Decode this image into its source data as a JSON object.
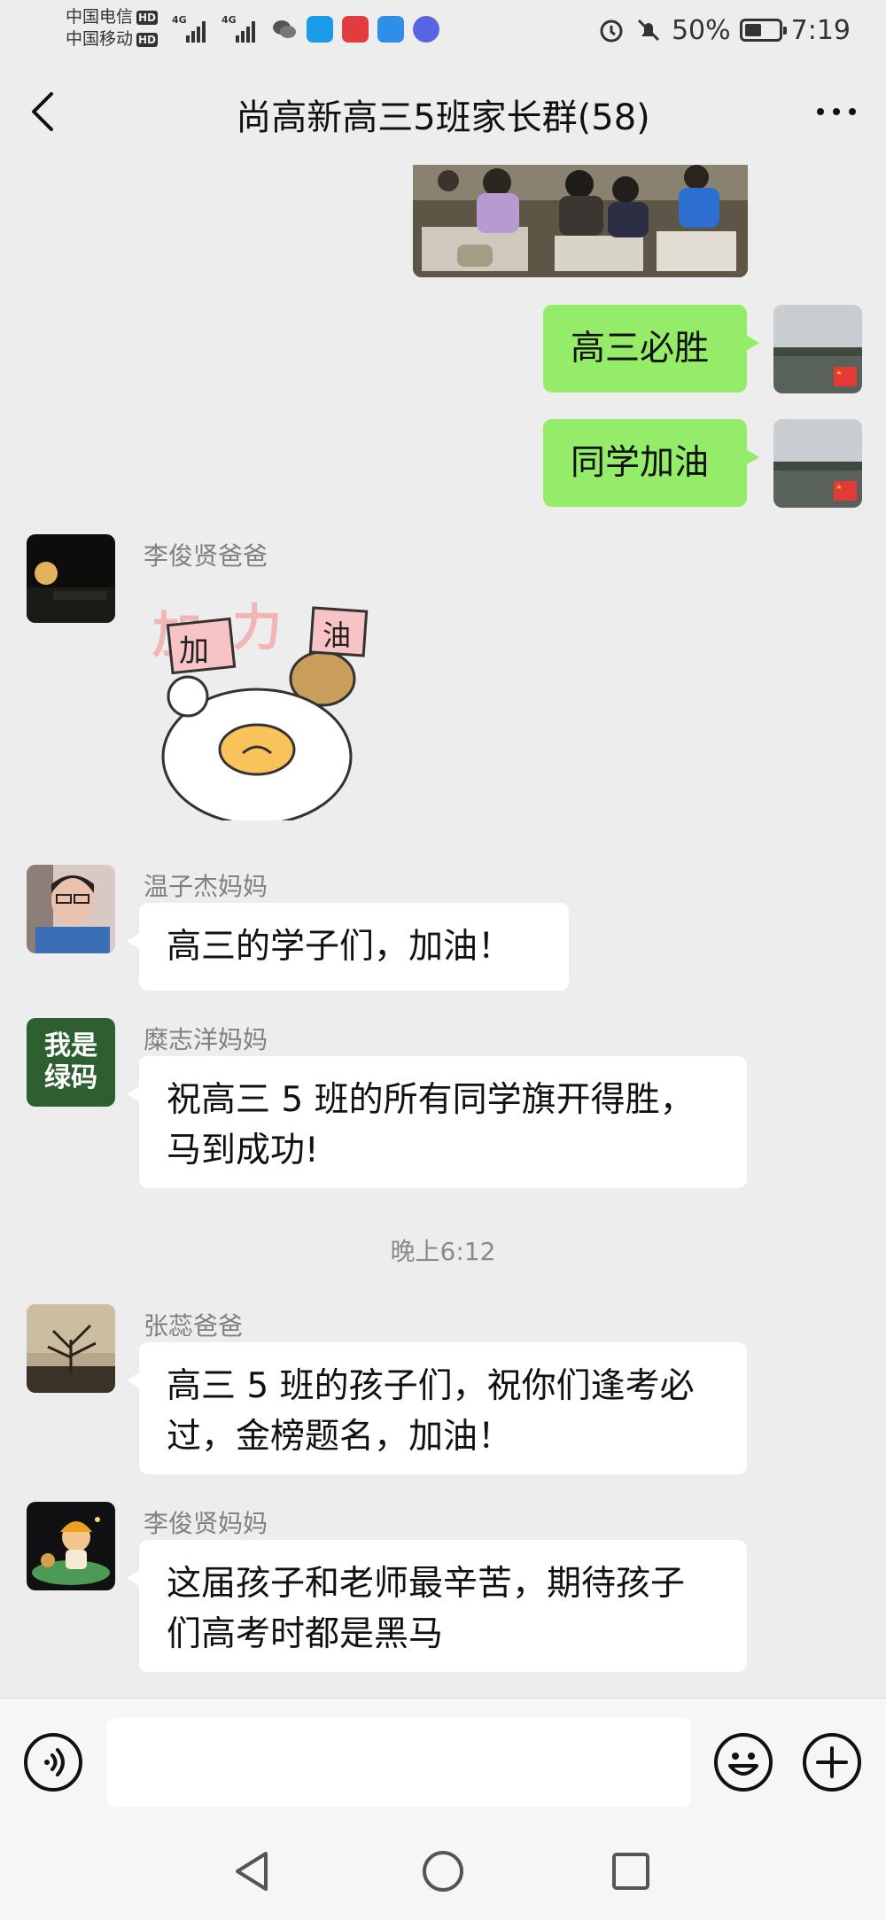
{
  "status_bar": {
    "carrier1": "中国电信",
    "carrier2": "中国移动",
    "hd_badge": "HD",
    "net1": "4G",
    "net2": "4G",
    "battery_percent": "50%",
    "battery_level": 0.5,
    "time": "7:19",
    "icons": [
      "wechat-icon",
      "search-app-icon",
      "reader-app-icon",
      "cloud-app-icon",
      "music-app-icon",
      "alarm-icon",
      "mute-icon"
    ]
  },
  "header": {
    "title": "尚高新高三5班家长群(58)"
  },
  "messages": [
    {
      "type": "image",
      "side": "right"
    },
    {
      "type": "text",
      "side": "right",
      "text": "高三必胜"
    },
    {
      "type": "text",
      "side": "right",
      "text": "同学加油"
    },
    {
      "type": "sticker",
      "side": "left",
      "sender": "李俊贤爸爸",
      "sticker_text": [
        "加",
        "力",
        "油"
      ]
    },
    {
      "type": "text",
      "side": "left",
      "sender": "温子杰妈妈",
      "text": "高三的学子们，加油！"
    },
    {
      "type": "text",
      "side": "left",
      "sender": "糜志洋妈妈",
      "avatar_text": [
        "我是",
        "绿码"
      ],
      "lines": [
        "祝高三 5 班的所有同学旗开得胜，",
        "马到成功!"
      ]
    },
    {
      "type": "time",
      "text": "晚上6:12"
    },
    {
      "type": "text",
      "side": "left",
      "sender": "张蕊爸爸",
      "lines": [
        "高三 5 班的孩子们，祝你们逢考必",
        "过，金榜题名，加油！"
      ]
    },
    {
      "type": "text",
      "side": "left",
      "sender": "李俊贤妈妈",
      "lines": [
        "这届孩子和老师最辛苦，期待孩子",
        "们高考时都是黑马"
      ]
    }
  ],
  "input_bar": {
    "text_value": "",
    "icons": [
      "voice-icon",
      "emoji-icon",
      "plus-icon"
    ]
  },
  "system_nav": {
    "icons": [
      "back-triangle-icon",
      "home-circle-icon",
      "recents-square-icon"
    ]
  }
}
